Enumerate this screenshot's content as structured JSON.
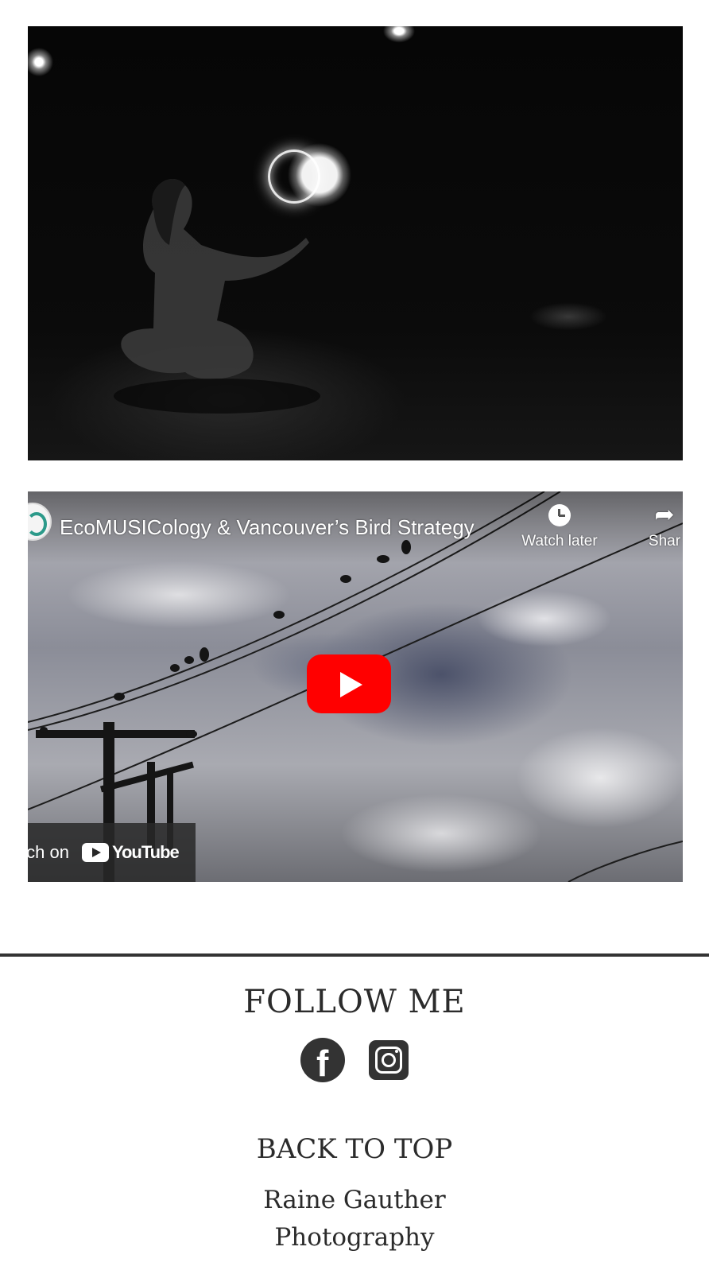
{
  "gallery": {
    "photo_alt": "Woman sitting cross-legged holding a glowing light orb"
  },
  "video": {
    "title": "EcoMUSICology & Vancouver’s Bird Strategy",
    "watch_later_label": "Watch later",
    "share_label": "Shar",
    "watch_on_label": "tch on",
    "youtube_label": "YouTube"
  },
  "footer": {
    "follow_title": "FOLLOW ME",
    "social": [
      {
        "icon": "facebook-icon"
      },
      {
        "icon": "instagram-icon"
      }
    ],
    "back_to_top": "BACK TO TOP",
    "site_name_line1": "Raine Gauther",
    "site_name_line2": "Photography"
  },
  "colors": {
    "text": "#2b2b2b",
    "divider": "#333333",
    "youtube_red": "#ff0000"
  }
}
